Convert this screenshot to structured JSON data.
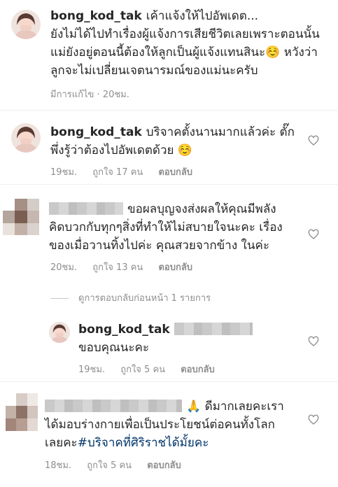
{
  "caption": {
    "username": "bong_kod_tak",
    "line1": "เค้าแจ้งให้ไปอัพเดต...",
    "line2": "ยังไม่ได้ไปทำเรื่องผู้แจ้งการเสียชีวิตเลยเพราะตอนนั้น",
    "line3": "แม่ยังอยู่ตอนนี้ต้องให้ลูกเป็นผู้แจ้งแทนสินะ☺️ หวังว่า",
    "line4": "ลูกจะไม่เปลี่ยนเจตนารมณ์ของแม่นะครับ",
    "edited": "มีการแก้ไข · 20ชม."
  },
  "comments": [
    {
      "username": "bong_kod_tak",
      "line1": "บริจาคตั้งนานมากแล้วค่ะ ตั๊ก",
      "line2": "พึ่งรู้ว่าต้องไปอัพเดตด้วย ☺️",
      "time": "19ชม.",
      "likes": "ถูกใจ 17 คน",
      "reply": "ตอบกลับ"
    },
    {
      "line1": "ขอผลบุญจงส่งผลให้คุณมีพลัง",
      "line2": "คิดบวกกับทุกๆสิ่งที่ทำให้ไม่สบายใจนะคะ เรื่อง",
      "line3": "ของเมื่อวานทิ้งไปค่ะ คุณสวยจากข้าง ในค่ะ",
      "time": "20ชม.",
      "likes": "ถูกใจ 13 คน",
      "reply": "ตอบกลับ"
    },
    {
      "view_previous": "ดูการตอบกลับก่อนหน้า 1 รายการ"
    },
    {
      "username": "bong_kod_tak",
      "line1": "ขอบคุณนะคะ",
      "time": "19ชม.",
      "likes": "ถูกใจ 5 คน",
      "reply": "ตอบกลับ"
    },
    {
      "emoji": "🙏",
      "line1": "ดีมากเลยคะเรา",
      "line2": "ได้มอบร่างกายเพื่อเป็นประโยชน์ต่อคนทั้งโลก",
      "line3_prefix": "เลยคะ",
      "hashtag": "#บริจาคที่ศิริราชได้มั้ยคะ",
      "time": "18ชม.",
      "likes": "ถูกใจ 5 คน",
      "reply": "ตอบกลับ"
    }
  ],
  "colors": {
    "text": "#262626",
    "meta": "#8e8e8e",
    "hashtag": "#003569",
    "divider": "#efefef"
  }
}
